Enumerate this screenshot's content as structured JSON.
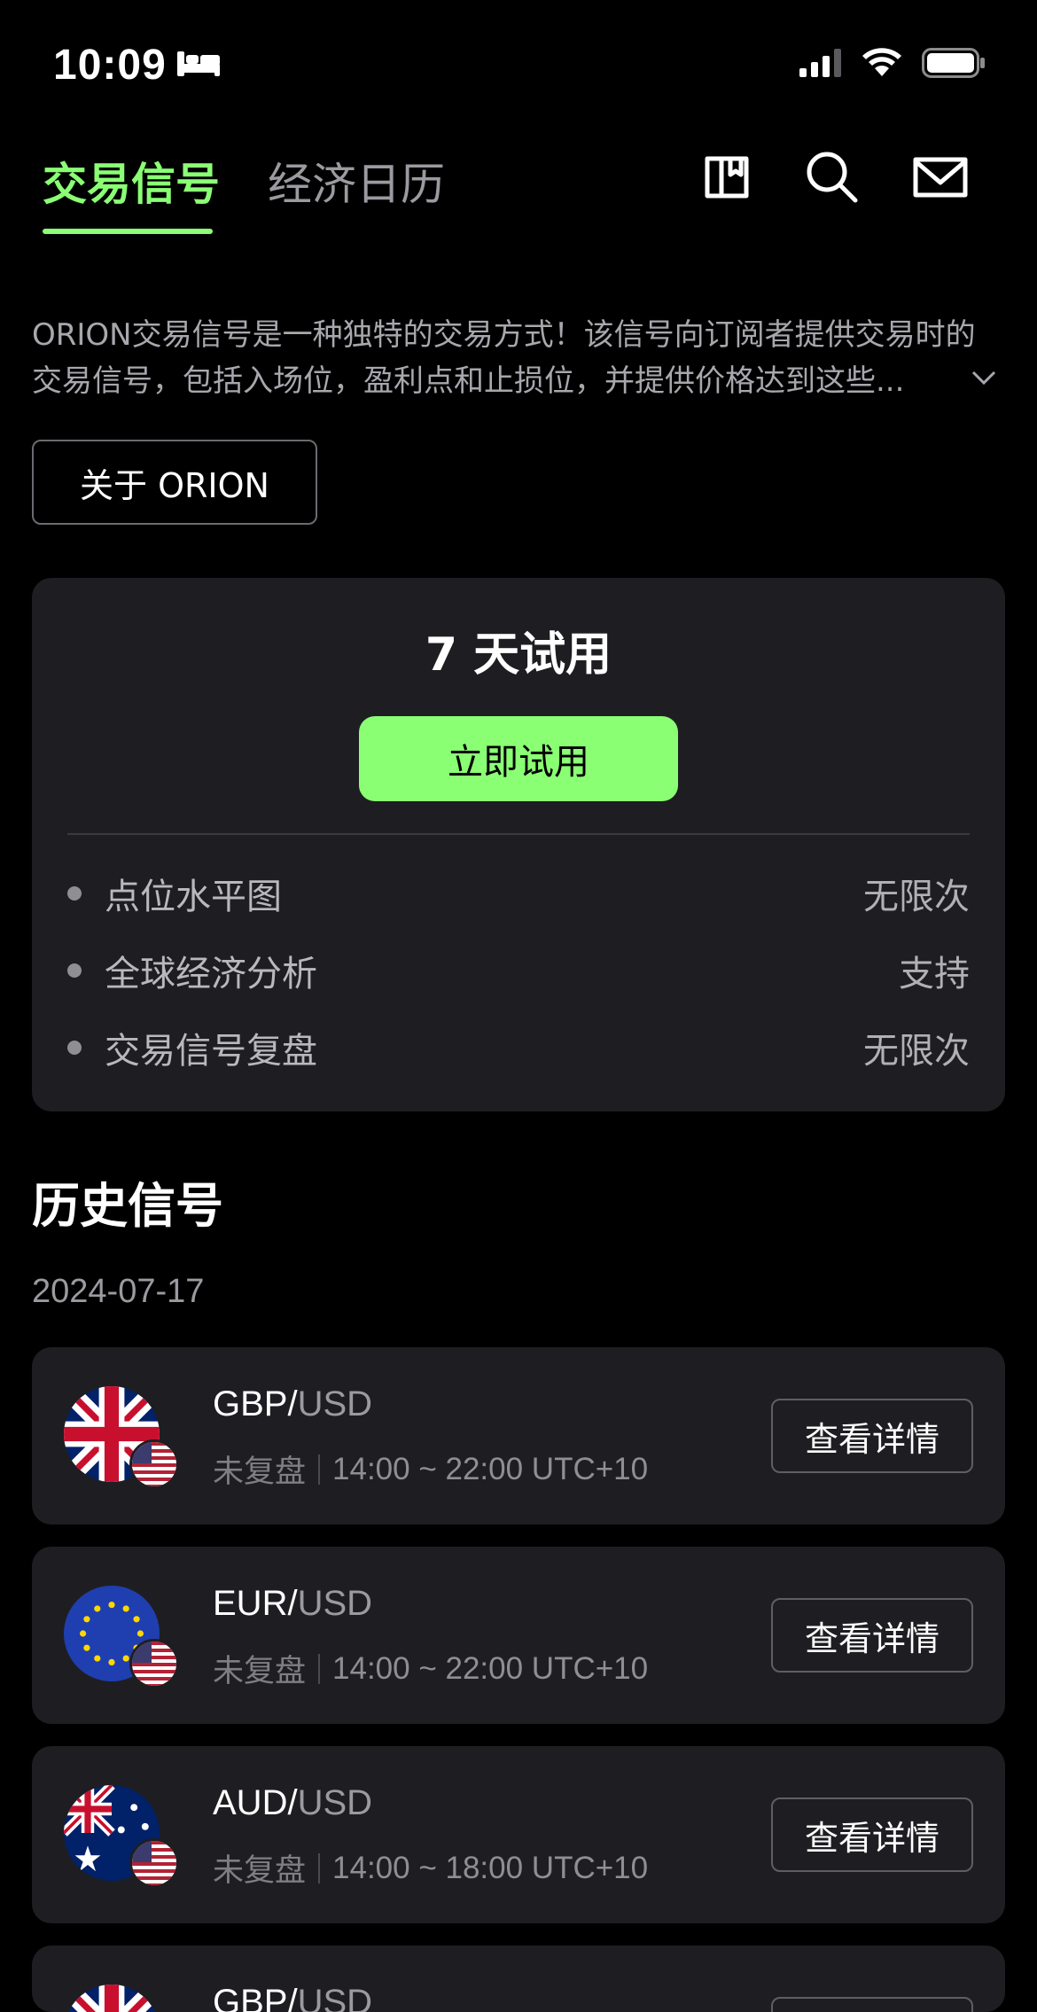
{
  "status_bar": {
    "time": "10:09",
    "icons": [
      "bed-icon",
      "cellular-signal-icon",
      "wifi-icon",
      "battery-icon"
    ]
  },
  "header": {
    "tabs": [
      {
        "label": "交易信号",
        "active": true
      },
      {
        "label": "经济日历",
        "active": false
      }
    ],
    "icons": [
      "book-icon",
      "search-icon",
      "mail-icon"
    ],
    "accent_color": "#8aff74"
  },
  "intro": {
    "text": "ORION交易信号是一种独特的交易方式！该信号向订阅者提供交易时的交易信号，包括入场位，盈利点和止损位，并提供价格达到这些...",
    "about_button": "关于 ORION"
  },
  "trial": {
    "title": "7 天试用",
    "button": "立即试用",
    "features": [
      {
        "name": "点位水平图",
        "value": "无限次"
      },
      {
        "name": "全球经济分析",
        "value": "支持"
      },
      {
        "name": "交易信号复盘",
        "value": "无限次"
      }
    ]
  },
  "history": {
    "title": "历史信号",
    "date": "2024-07-17",
    "signals": [
      {
        "base": "GBP/",
        "quote": "USD",
        "status": "未复盘",
        "time": "14:00 ~ 22:00 UTC+10",
        "button": "查看详情",
        "flag": "uk-flag-icon"
      },
      {
        "base": "EUR/",
        "quote": "USD",
        "status": "未复盘",
        "time": "14:00 ~ 22:00 UTC+10",
        "button": "查看详情",
        "flag": "eu-flag-icon"
      },
      {
        "base": "AUD/",
        "quote": "USD",
        "status": "未复盘",
        "time": "14:00 ~ 18:00 UTC+10",
        "button": "查看详情",
        "flag": "au-flag-icon"
      },
      {
        "base": "GBP/",
        "quote": "USD",
        "status": "",
        "time": "",
        "button": "",
        "flag": "uk-flag-icon"
      }
    ]
  }
}
